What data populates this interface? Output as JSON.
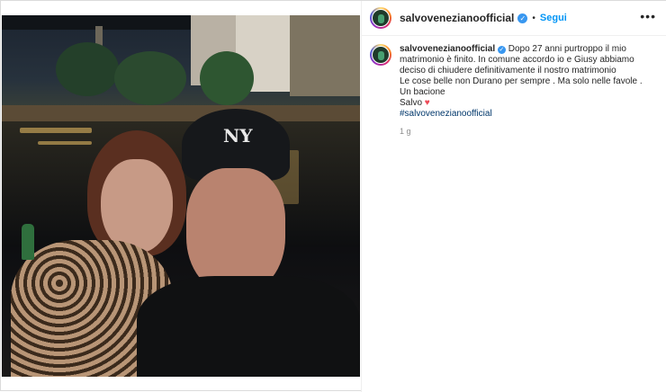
{
  "post": {
    "username": "salvoveneziano",
    "username_header": "salvovenezianoofficial",
    "verified_icon": "verified-badge-icon",
    "separator": "•",
    "follow_label": "Segui",
    "more_icon": "more-options-icon",
    "caption_username": "salvovenezianoofficial",
    "caption_line1": "Dopo 27 anni purtroppo il mio",
    "caption_line2": "matrimonio è finito. In comune accordo io e Giusy abbiamo",
    "caption_line3": "deciso di chiudere definitivamente il nostro matrimonio",
    "caption_line4": "Le cose belle non Durano per sempre . Ma solo nelle favole .",
    "caption_line5": "Un bacione",
    "caption_line6": "Salvo",
    "heart_icon": "heart-icon",
    "heart_symbol": "♥",
    "hashtag": "#salvovenezianoofficial",
    "time": "1 g"
  },
  "photo": {
    "cap_logo": "NY"
  },
  "colors": {
    "accent": "#0095f6",
    "verified": "#3897f0",
    "heart": "#ed4956"
  }
}
